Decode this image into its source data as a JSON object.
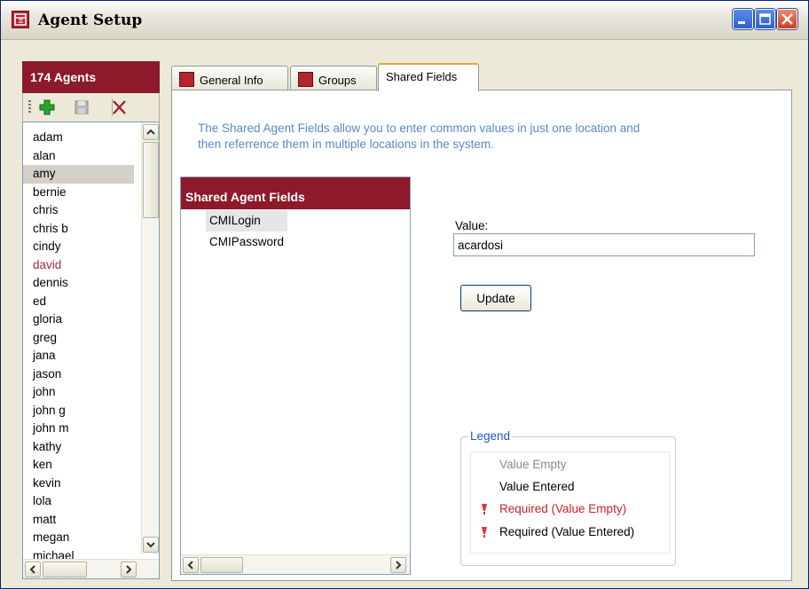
{
  "window": {
    "title": "Agent Setup",
    "icon": "agent-setup-app-icon",
    "controls": [
      "minimize-icon",
      "maximize-icon",
      "close-icon"
    ]
  },
  "agents": {
    "header": "174  Agents",
    "toolbar": {
      "add_icon": "plus-icon",
      "save_icon": "save-icon",
      "delete_icon": "delete-x-icon"
    },
    "items": [
      {
        "label": "adam"
      },
      {
        "label": "alan"
      },
      {
        "label": "amy",
        "selected": true
      },
      {
        "label": "bernie"
      },
      {
        "label": "chris"
      },
      {
        "label": "chris b"
      },
      {
        "label": "cindy"
      },
      {
        "label": "david",
        "color": "#a8283c"
      },
      {
        "label": "dennis"
      },
      {
        "label": "ed"
      },
      {
        "label": "gloria"
      },
      {
        "label": "greg"
      },
      {
        "label": "jana"
      },
      {
        "label": "jason"
      },
      {
        "label": "john"
      },
      {
        "label": "john g"
      },
      {
        "label": "john m"
      },
      {
        "label": "kathy"
      },
      {
        "label": "ken"
      },
      {
        "label": "kevin"
      },
      {
        "label": "lola"
      },
      {
        "label": "matt"
      },
      {
        "label": "megan"
      },
      {
        "label": "michael"
      }
    ]
  },
  "tabs": [
    {
      "label": "General Info",
      "icon": "general-info-icon"
    },
    {
      "label": "Groups",
      "icon": "groups-icon"
    },
    {
      "label": "Shared Fields",
      "active": true
    }
  ],
  "shared": {
    "description": "The Shared Agent Fields allow you to enter common values in just one location and then referrence them in multiple locations in the system.",
    "panel_title": "Shared Agent Fields",
    "fields": [
      {
        "label": "CMILogin",
        "selected": true
      },
      {
        "label": "CMIPassword"
      }
    ],
    "value_label": "Value:",
    "value": "acardosi",
    "update_label": "Update"
  },
  "legend": {
    "title": "Legend",
    "items": [
      {
        "label": "Value Empty",
        "color": "#8a8a8a"
      },
      {
        "label": "Value Entered",
        "color": "#000000"
      },
      {
        "label": "Required (Value Empty)",
        "color": "#cc2222",
        "icon": "required-marker-icon"
      },
      {
        "label": "Required (Value Entered)",
        "color": "#000000",
        "icon": "required-marker-icon"
      }
    ]
  },
  "colors": {
    "header_maroon": "#8c1a2a",
    "description_blue": "#5a88c8",
    "tab_highlight": "#e6a23c"
  }
}
